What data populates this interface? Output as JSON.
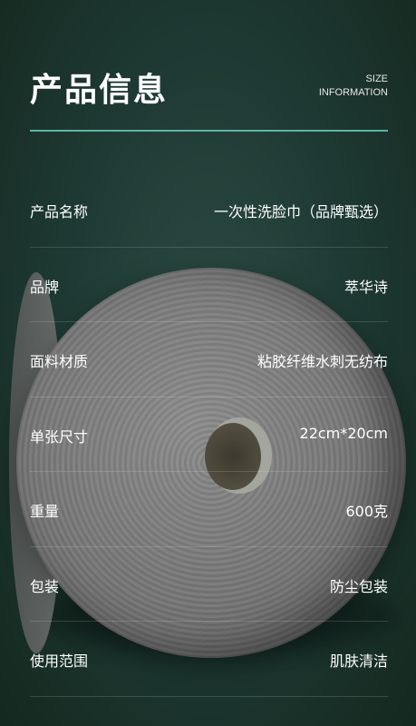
{
  "header": {
    "title": "产品信息",
    "subtitle_line1": "SIZE",
    "subtitle_line2": "INFORMATION"
  },
  "rows": [
    {
      "label": "产品名称",
      "value": "一次性洗脸巾（品牌甄选）"
    },
    {
      "label": "品牌",
      "value": "萃华诗"
    },
    {
      "label": "面料材质",
      "value": "粘胶纤维水刺无纺布"
    },
    {
      "label": "单张尺寸",
      "value": "22cm*20cm"
    },
    {
      "label": "重量",
      "value": "600克"
    },
    {
      "label": "包装",
      "value": "防尘包装"
    },
    {
      "label": "使用范围",
      "value": "肌肤清洁"
    }
  ],
  "colors": {
    "background": "#1f3a34",
    "accent_line": "#5fb3a6",
    "text": "#ffffff"
  }
}
